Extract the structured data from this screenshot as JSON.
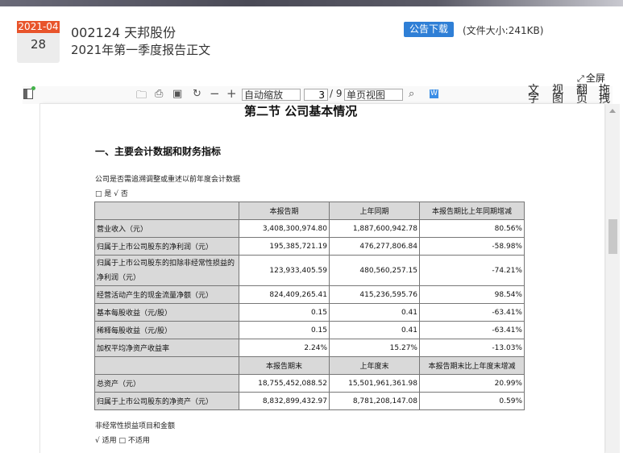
{
  "announcement": {
    "date_year_month": "2021-04",
    "date_day": "28",
    "stock_code_name": "002124 天邦股份",
    "report_title": "2021年第一季度报告正文",
    "download_label": "公告下载",
    "file_size_text": "(文件大小:241KB)"
  },
  "viewer": {
    "fullscreen_label": "全屏",
    "zoom_value": "自动缩放",
    "page_current": "3",
    "page_total": "/ 9",
    "view_mode": "单页视图",
    "vertical_tools": [
      "文字",
      "视图",
      "翻页",
      "拖拽"
    ]
  },
  "document": {
    "section_title": "第二节 公司基本情况",
    "sub_heading": "一、主要会计数据和财务指标",
    "restate_question": "公司是否需追溯调整或重述以前年度会计数据",
    "restate_answer": "□ 是 √ 否",
    "table_headers_1": [
      "",
      "本报告期",
      "上年同期",
      "本报告期比上年同期增减"
    ],
    "table_rows_1": [
      [
        "营业收入（元）",
        "3,408,300,974.80",
        "1,887,600,942.78",
        "80.56%"
      ],
      [
        "归属于上市公司股东的净利润（元）",
        "195,385,721.19",
        "476,277,806.84",
        "-58.98%"
      ],
      [
        "归属于上市公司股东的扣除非经常性损益的净利润（元）",
        "123,933,405.59",
        "480,560,257.15",
        "-74.21%"
      ],
      [
        "经营活动产生的现金流量净额（元）",
        "824,409,265.41",
        "415,236,595.76",
        "98.54%"
      ],
      [
        "基本每股收益（元/股）",
        "0.15",
        "0.41",
        "-63.41%"
      ],
      [
        "稀释每股收益（元/股）",
        "0.15",
        "0.41",
        "-63.41%"
      ],
      [
        "加权平均净资产收益率",
        "2.24%",
        "15.27%",
        "-13.03%"
      ]
    ],
    "table_headers_2": [
      "",
      "本报告期末",
      "上年度末",
      "本报告期末比上年度末增减"
    ],
    "table_rows_2": [
      [
        "总资产（元）",
        "18,755,452,088.52",
        "15,501,961,361.98",
        "20.99%"
      ],
      [
        "归属于上市公司股东的净资产（元）",
        "8,832,899,432.97",
        "8,781,208,147.08",
        "0.59%"
      ]
    ],
    "nonrecurring_label": "非经常性损益项目和金额",
    "nonrecurring_answer": "√ 适用 □ 不适用"
  }
}
